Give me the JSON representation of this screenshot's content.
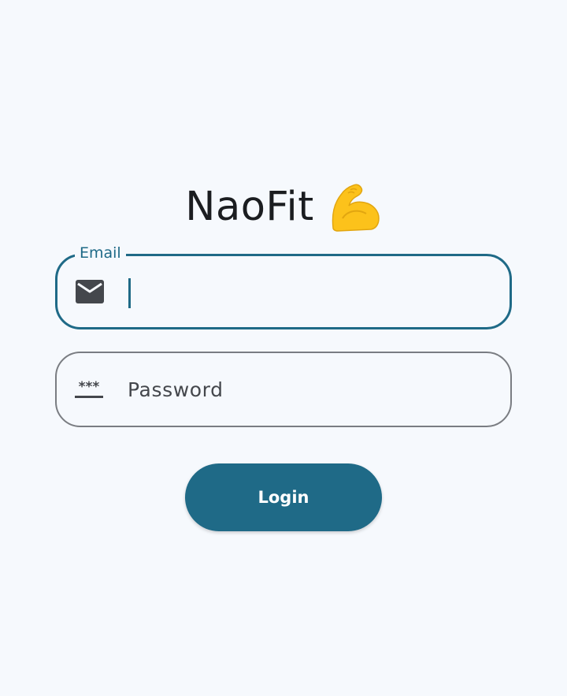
{
  "app": {
    "title": "NaoFit",
    "title_icon": "flexed-biceps-emoji"
  },
  "login_form": {
    "email": {
      "label": "Email",
      "value": "",
      "icon": "mail-icon"
    },
    "password": {
      "placeholder": "Password",
      "value": "",
      "icon": "password-icon"
    },
    "login_button": {
      "label": "Login"
    }
  },
  "colors": {
    "background": "#f6f9fd",
    "primary": "#1f6a87",
    "outline": "#7a7d82",
    "text": "#1b1d20"
  }
}
